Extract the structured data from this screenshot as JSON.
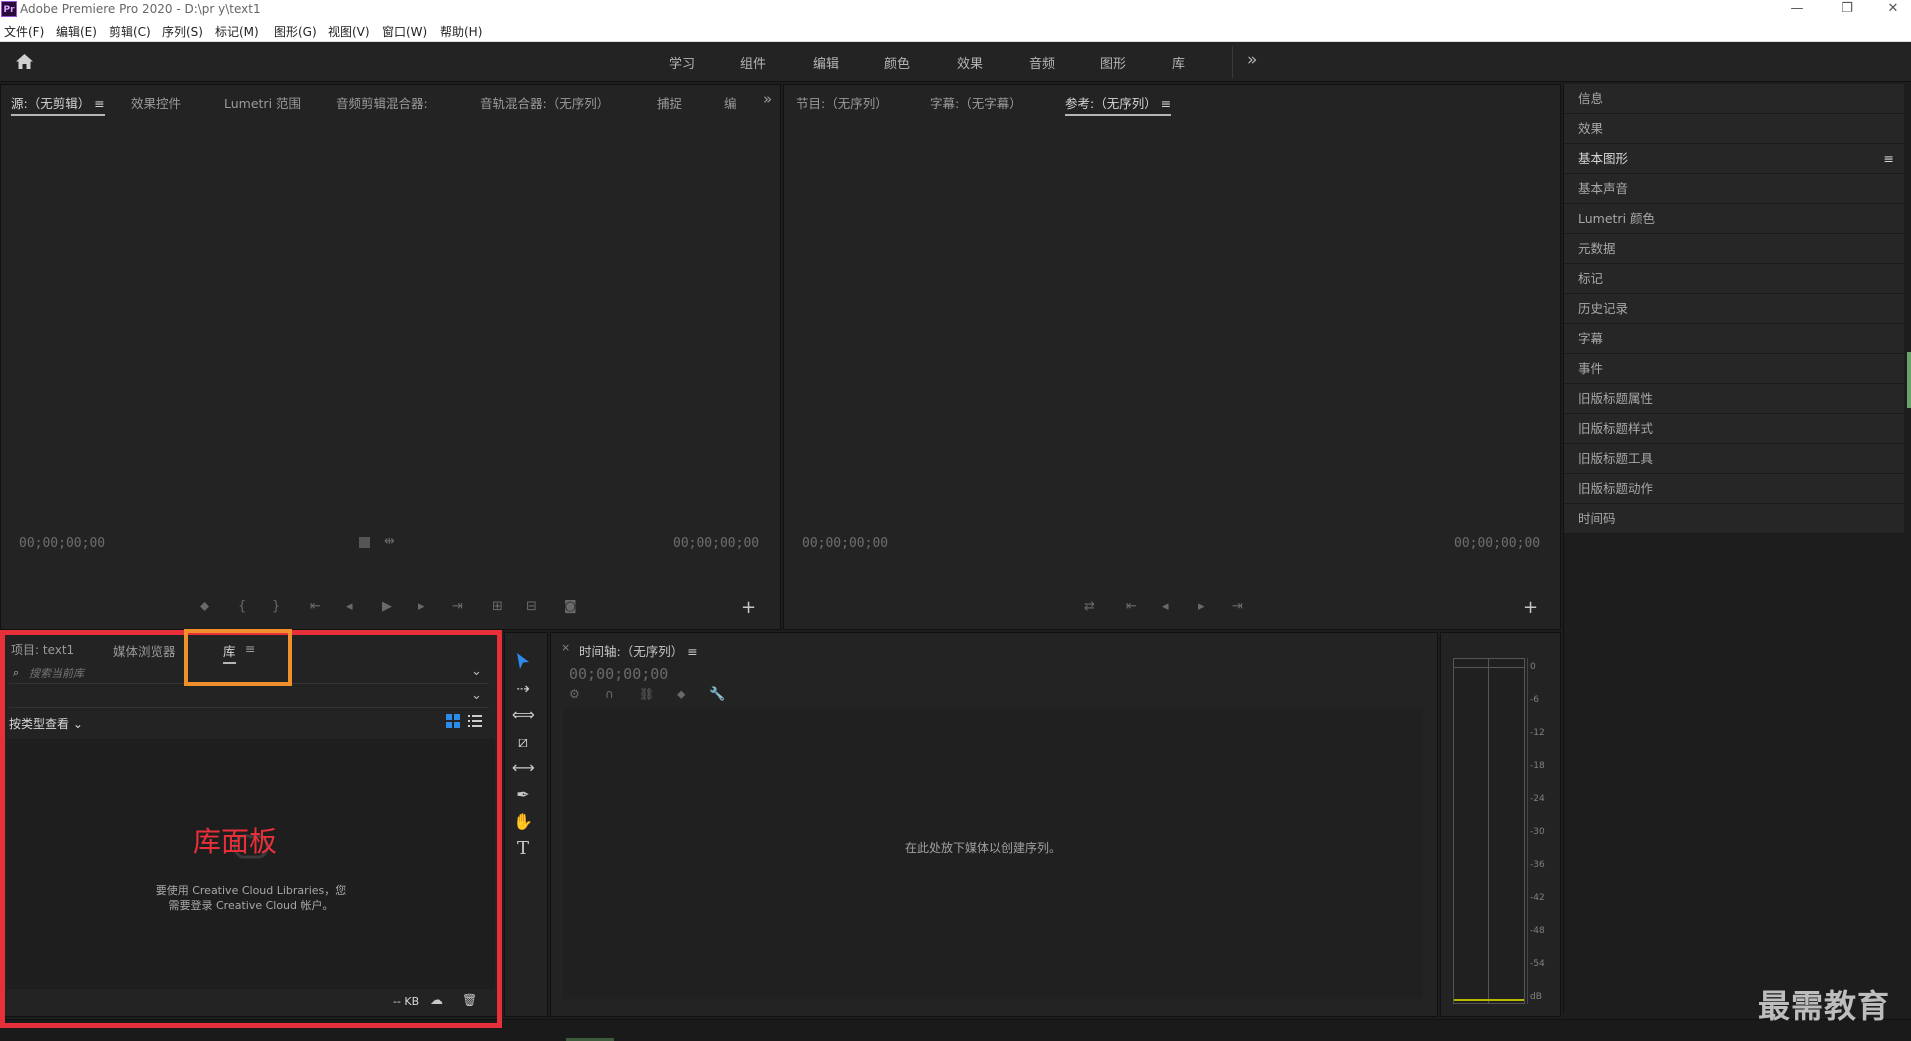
{
  "window": {
    "app_icon": "Pr",
    "title": "Adobe Premiere Pro 2020 - D:\\pr y\\text1",
    "minimize": "—",
    "restore": "❐",
    "close": "✕"
  },
  "menu": [
    "文件(F)",
    "编辑(E)",
    "剪辑(C)",
    "序列(S)",
    "标记(M)",
    "图形(G)",
    "视图(V)",
    "窗口(W)",
    "帮助(H)"
  ],
  "workspaces": [
    "学习",
    "组件",
    "编辑",
    "颜色",
    "效果",
    "音频",
    "图形",
    "库"
  ],
  "workspace_more": "»",
  "source_panel": {
    "tabs": [
      "源:（无剪辑）",
      "效果控件",
      "Lumetri 范围",
      "音频剪辑混合器:",
      "音轨混合器:（无序列）",
      "捕捉",
      "编"
    ],
    "more": "»",
    "tc_left": "00;00;00;00",
    "tc_right": "00;00;00;00"
  },
  "program_panel": {
    "tabs": [
      "节目:（无序列）",
      "字幕:（无字幕）",
      "参考:（无序列）"
    ],
    "tc_left": "00;00;00;00",
    "tc_right": "00;00;00;00"
  },
  "right_panel": {
    "items": [
      "信息",
      "效果",
      "基本图形",
      "基本声音",
      "Lumetri 颜色",
      "元数据",
      "标记",
      "历史记录",
      "字幕",
      "事件",
      "旧版标题属性",
      "旧版标题样式",
      "旧版标题工具",
      "旧版标题动作",
      "时间码"
    ]
  },
  "library_panel": {
    "tabs": [
      "项目: text1",
      "媒体浏览器",
      "库"
    ],
    "search_placeholder": "搜索当前库",
    "view_by": "按类型查看",
    "annotation": "库面板",
    "message_line1": "要使用 Creative Cloud Libraries，您",
    "message_line2": "需要登录 Creative Cloud 帐户。",
    "storage": "-- KB"
  },
  "timeline_panel": {
    "title": "时间轴:（无序列）",
    "timecode": "00;00;00;00",
    "drop_hint": "在此处放下媒体以创建序列。"
  },
  "audio_meter": {
    "labels": [
      "0",
      "-6",
      "-12",
      "-18",
      "-24",
      "-30",
      "-36",
      "-42",
      "-48",
      "-54",
      "dB"
    ]
  },
  "watermark": "最需教育",
  "colors": {
    "annotation_red": "#e8303a",
    "annotation_orange": "#f0902c",
    "selection_blue": "#2d8ceb"
  }
}
